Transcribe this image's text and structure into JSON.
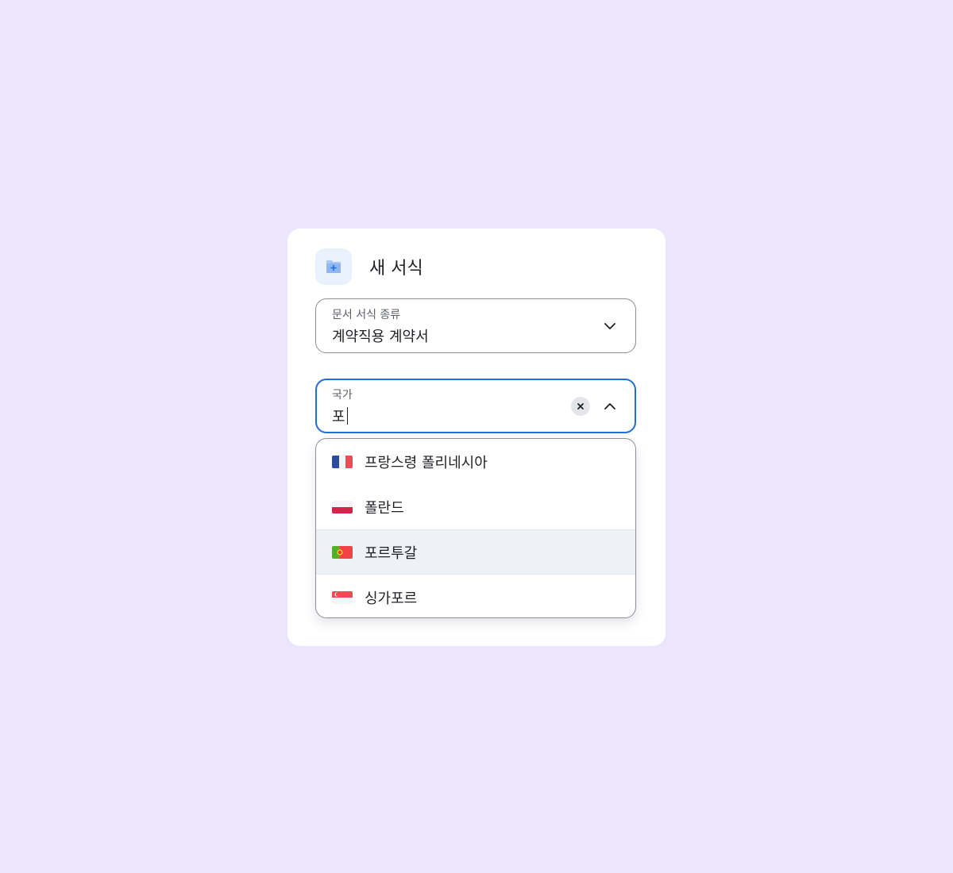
{
  "dialog": {
    "title": "새 서식",
    "icon": "new-folder-icon"
  },
  "doc_type_field": {
    "label": "문서 서식 종류",
    "value": "계약직용 계약서",
    "icon": "chevron-down-icon"
  },
  "country_field": {
    "label": "국가",
    "value": "포",
    "clear_icon": "clear-icon",
    "icon": "chevron-up-icon"
  },
  "country_options": [
    {
      "label": "프랑스령 폴리네시아",
      "flag": "flag-france-icon"
    },
    {
      "label": "폴란드",
      "flag": "flag-poland-icon"
    },
    {
      "label": "포르투갈",
      "flag": "flag-portugal-icon",
      "highlighted": true
    },
    {
      "label": "싱가포르",
      "flag": "flag-singapore-icon"
    }
  ],
  "colors": {
    "background": "#ece6fd",
    "accent": "#1f6fd4",
    "highlight": "#eef1f5"
  }
}
